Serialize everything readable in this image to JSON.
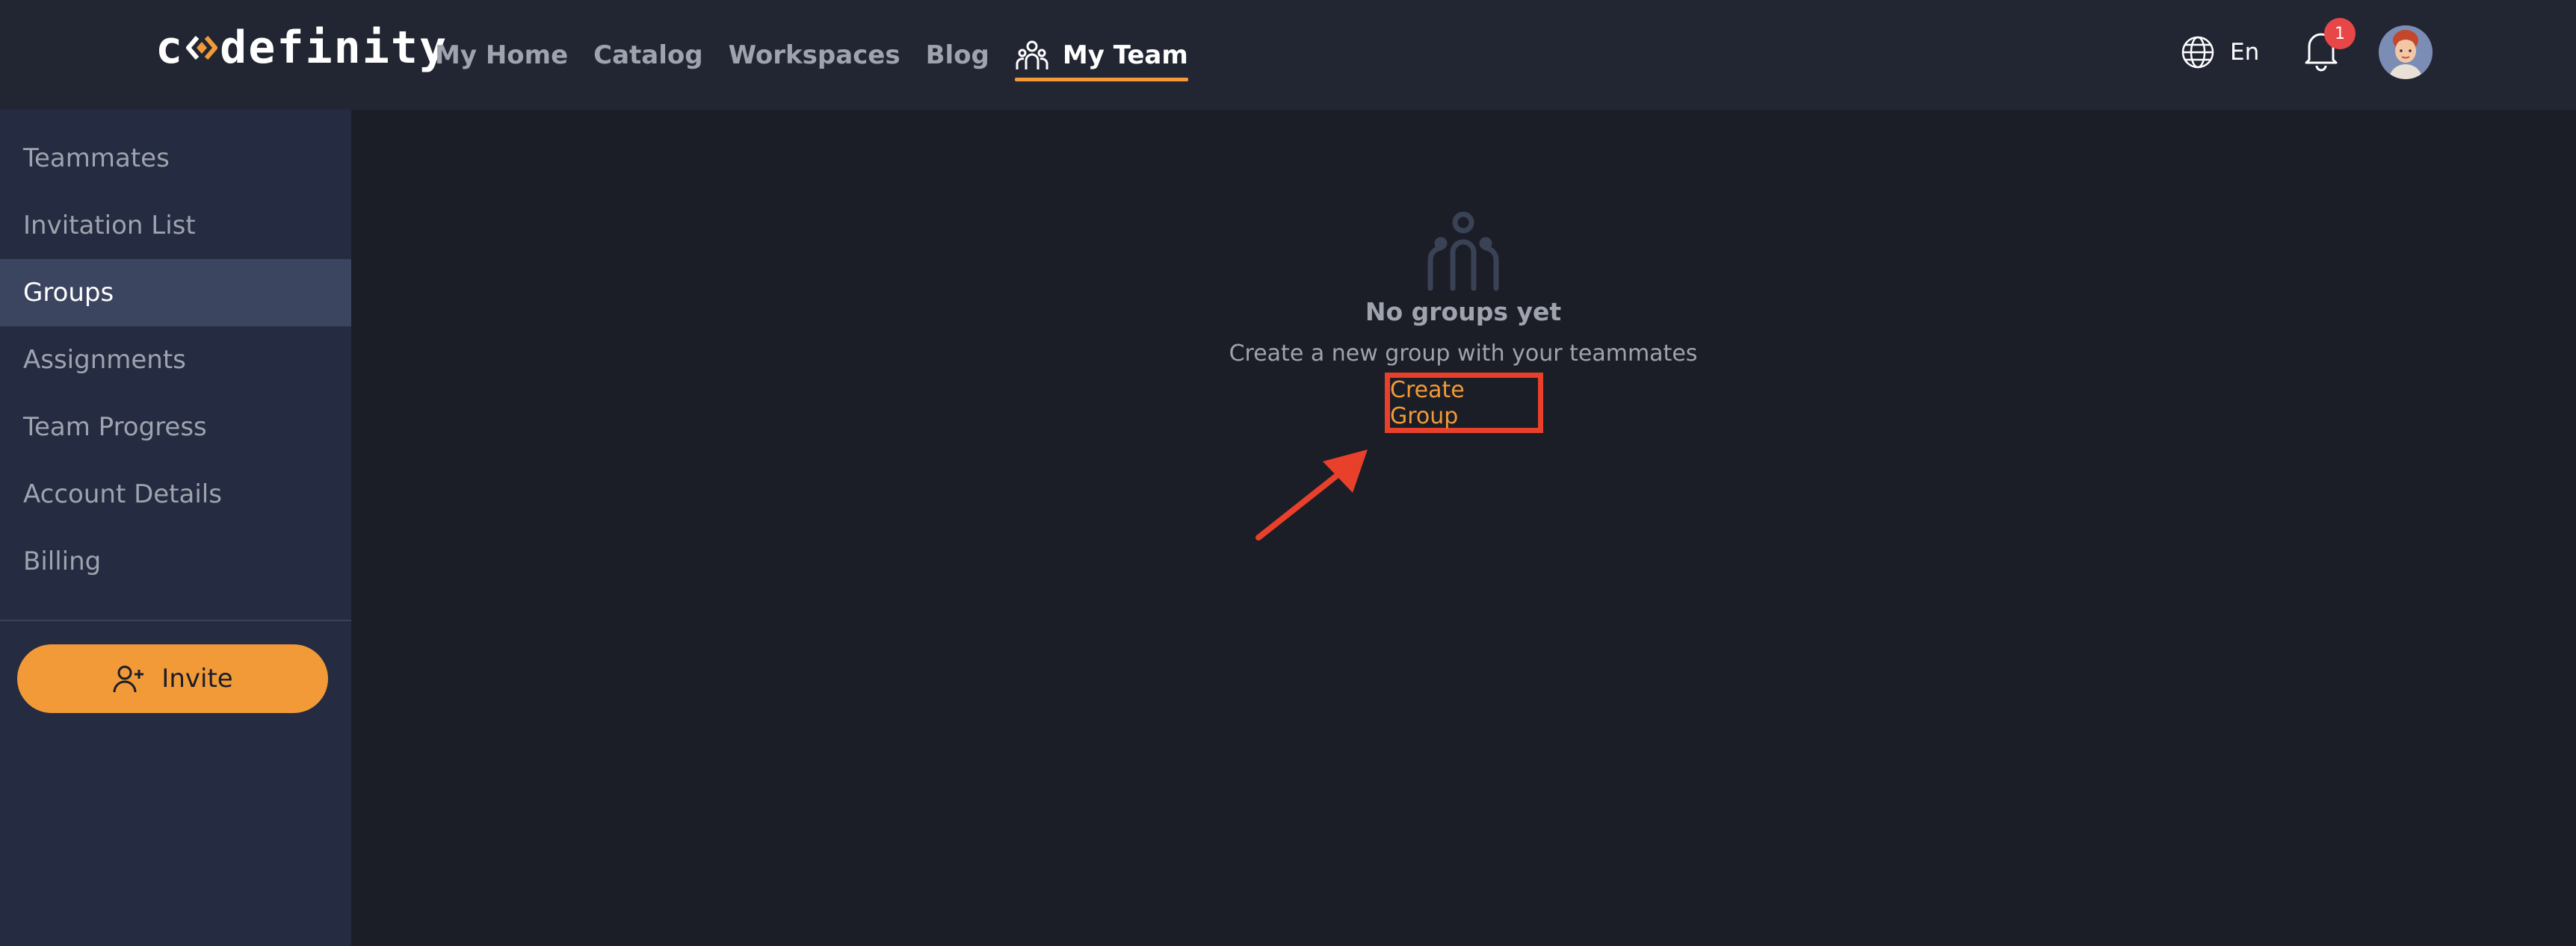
{
  "header": {
    "logo_text": "codefinity",
    "nav": [
      {
        "label": "My Home"
      },
      {
        "label": "Catalog"
      },
      {
        "label": "Workspaces"
      },
      {
        "label": "Blog"
      },
      {
        "label": "My Team",
        "active": true
      }
    ],
    "language": "En",
    "notifications_count": "1",
    "icons": {
      "team": "team-icon",
      "globe": "globe-icon",
      "bell": "bell-icon",
      "avatar": "avatar"
    }
  },
  "sidebar": {
    "items": [
      {
        "label": "Teammates"
      },
      {
        "label": "Invitation List"
      },
      {
        "label": "Groups",
        "active": true
      },
      {
        "label": "Assignments"
      },
      {
        "label": "Team Progress"
      },
      {
        "label": "Account Details"
      },
      {
        "label": "Billing"
      }
    ],
    "invite_label": "Invite"
  },
  "main": {
    "empty_title": "No groups yet",
    "empty_subtitle": "Create a new group with your teammates",
    "create_link": "Create Group"
  },
  "colors": {
    "accent": "#f29a38",
    "highlight": "#e8402a",
    "header_bg": "#222633",
    "sidebar_bg": "#252b40",
    "main_bg": "#1b1e27",
    "badge": "#e84747"
  }
}
